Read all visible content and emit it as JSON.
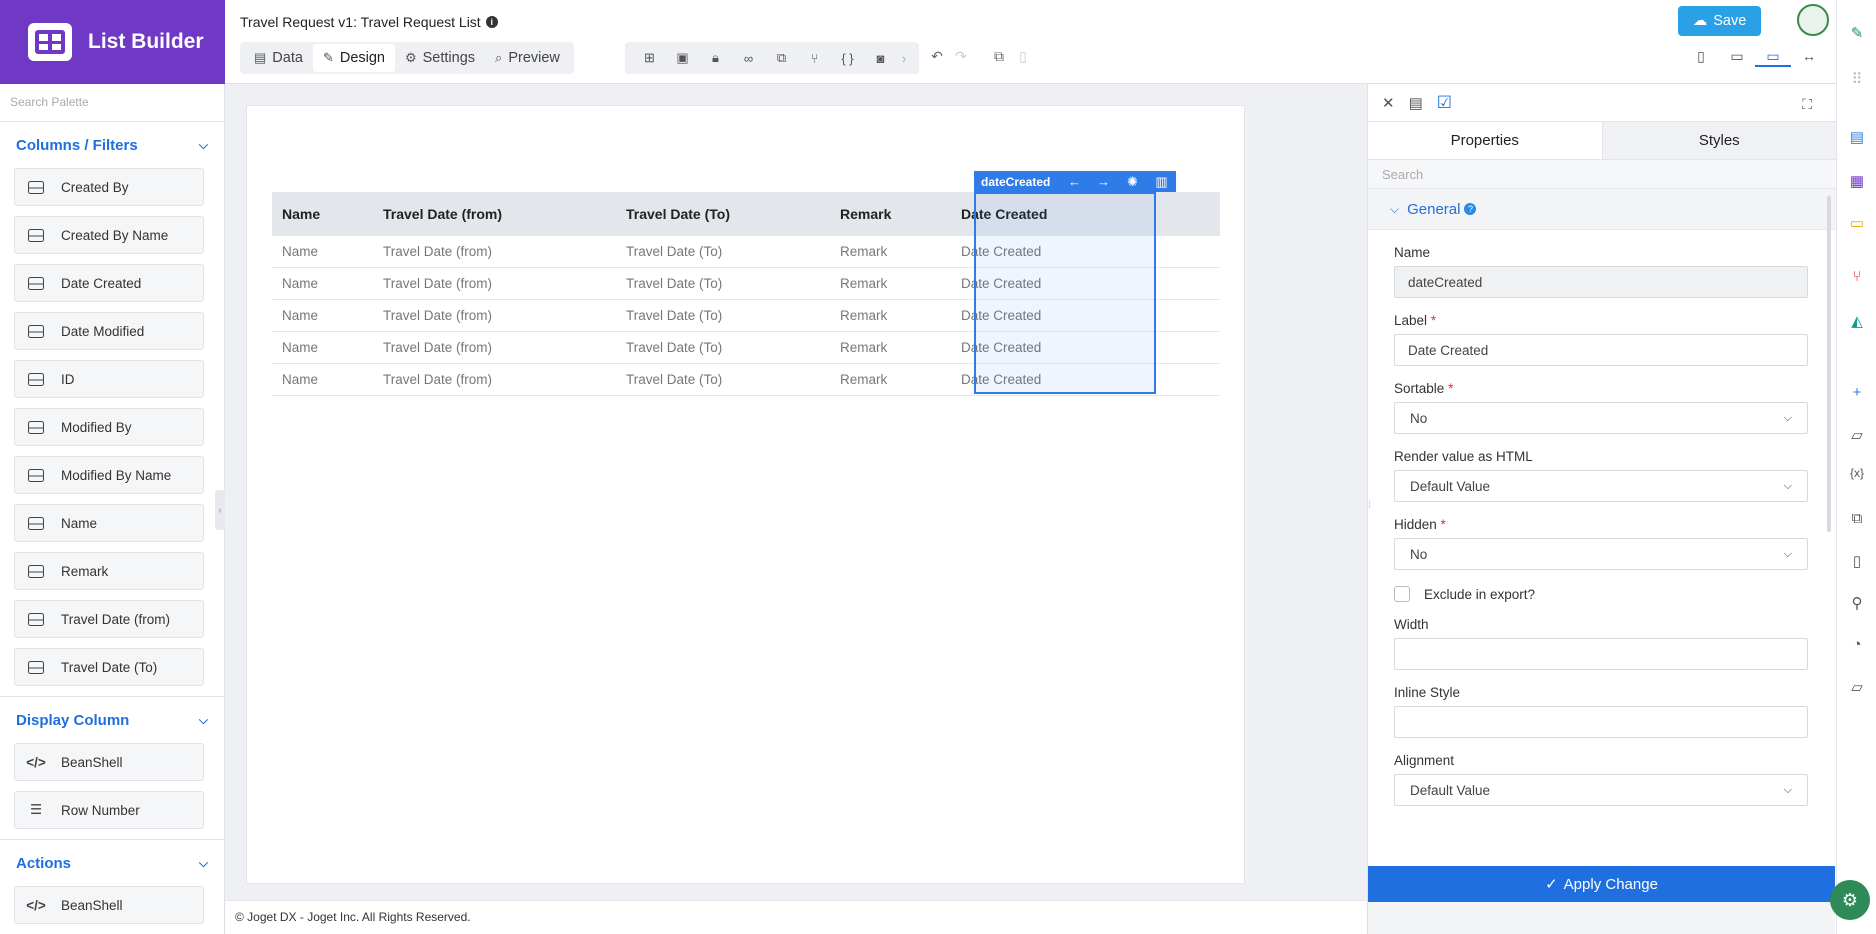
{
  "brand": {
    "title": "List Builder"
  },
  "palette": {
    "search_placeholder": "Search Palette",
    "sections": [
      {
        "title": "Columns / Filters",
        "items": [
          "Created By",
          "Created By Name",
          "Date Created",
          "Date Modified",
          "ID",
          "Modified By",
          "Modified By Name",
          "Name",
          "Remark",
          "Travel Date (from)",
          "Travel Date (To)"
        ]
      },
      {
        "title": "Display Column",
        "items": [
          "BeanShell",
          "Row Number"
        ]
      },
      {
        "title": "Actions",
        "items": [
          "BeanShell"
        ]
      }
    ]
  },
  "header": {
    "doc_title": "Travel Request v1: Travel Request List",
    "tabs": [
      {
        "label": "Data",
        "icon": "data-icon"
      },
      {
        "label": "Design",
        "icon": "design-icon",
        "active": true
      },
      {
        "label": "Settings",
        "icon": "gear-icon"
      },
      {
        "label": "Preview",
        "icon": "preview-icon"
      }
    ],
    "save_label": "Save"
  },
  "canvas": {
    "columns": [
      "Name",
      "Travel Date (from)",
      "Travel Date (To)",
      "Remark",
      "Date Created"
    ],
    "rows": [
      [
        "Name",
        "Travel Date (from)",
        "Travel Date (To)",
        "Remark",
        "Date Created"
      ],
      [
        "Name",
        "Travel Date (from)",
        "Travel Date (To)",
        "Remark",
        "Date Created"
      ],
      [
        "Name",
        "Travel Date (from)",
        "Travel Date (To)",
        "Remark",
        "Date Created"
      ],
      [
        "Name",
        "Travel Date (from)",
        "Travel Date (To)",
        "Remark",
        "Date Created"
      ],
      [
        "Name",
        "Travel Date (from)",
        "Travel Date (To)",
        "Remark",
        "Date Created"
      ]
    ],
    "selected_label": "dateCreated"
  },
  "footer": {
    "text": "© Joget DX - Joget Inc. All Rights Reserved."
  },
  "properties": {
    "tabs": [
      "Properties",
      "Styles"
    ],
    "search_placeholder": "Search",
    "section_title": "General",
    "name_label": "Name",
    "name_value": "dateCreated",
    "label_label": "Label",
    "label_value": "Date Created",
    "sortable_label": "Sortable",
    "sortable_value": "No",
    "render_html_label": "Render value as HTML",
    "render_html_value": "Default Value",
    "hidden_label": "Hidden",
    "hidden_value": "No",
    "exclude_export_label": "Exclude in export?",
    "width_label": "Width",
    "width_value": "",
    "inline_style_label": "Inline Style",
    "inline_style_value": "",
    "alignment_label": "Alignment",
    "alignment_value": "Default Value",
    "apply_label": "Apply Change"
  },
  "colors": {
    "brand": "#6f38c5",
    "accent": "#1f6fe0",
    "save": "#2aa0e6"
  }
}
